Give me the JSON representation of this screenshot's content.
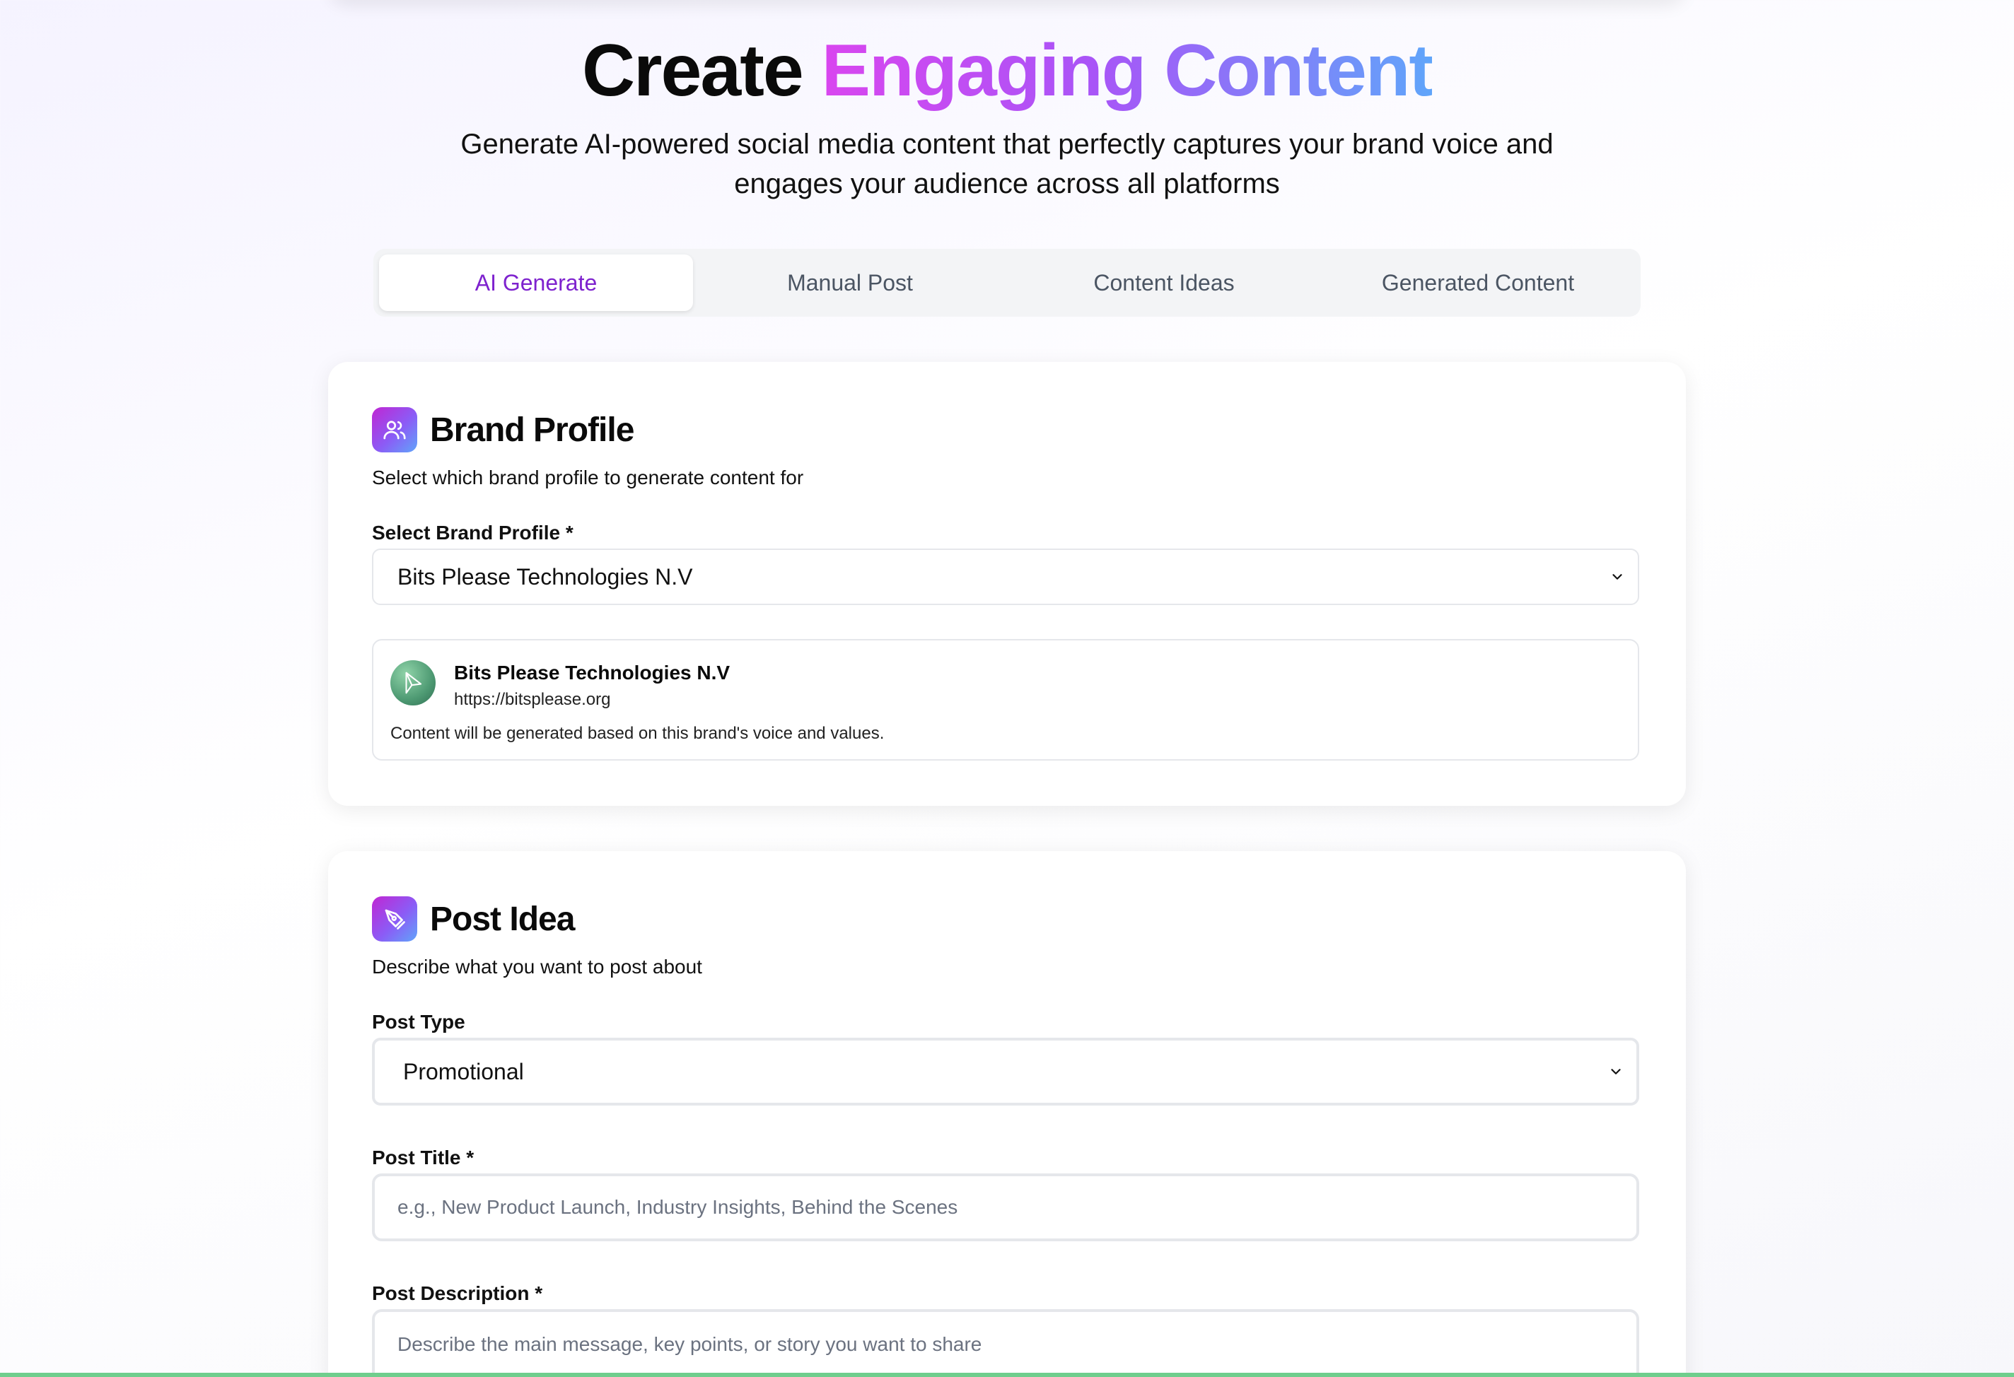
{
  "hero": {
    "title_plain": "Create",
    "title_gradient": "Engaging Content",
    "subtitle": "Generate AI-powered social media content that perfectly captures your brand voice and engages your audience across all platforms"
  },
  "tabs": [
    {
      "label": "AI Generate",
      "active": true
    },
    {
      "label": "Manual Post",
      "active": false
    },
    {
      "label": "Content Ideas",
      "active": false
    },
    {
      "label": "Generated Content",
      "active": false
    }
  ],
  "brand_profile": {
    "icon": "users-icon",
    "title": "Brand Profile",
    "description": "Select which brand profile to generate content for",
    "select_label": "Select Brand Profile *",
    "selected": "Bits Please Technologies N.V",
    "info": {
      "name": "Bits Please Technologies N.V",
      "url": "https://bitsplease.org",
      "note": "Content will be generated based on this brand's voice and values."
    }
  },
  "post_idea": {
    "icon": "pen-tool-icon",
    "title": "Post Idea",
    "description": "Describe what you want to post about",
    "post_type_label": "Post Type",
    "post_type_value": "Promotional",
    "post_title_label": "Post Title *",
    "post_title_placeholder": "e.g., New Product Launch, Industry Insights, Behind the Scenes",
    "post_description_label": "Post Description *",
    "post_description_placeholder": "Describe the main message, key points, or story you want to share"
  },
  "colors": {
    "accent": "#7e22ce",
    "gradient_start": "#d946ef",
    "gradient_end": "#60a5fa",
    "bottom_line": "#6fce8d"
  }
}
